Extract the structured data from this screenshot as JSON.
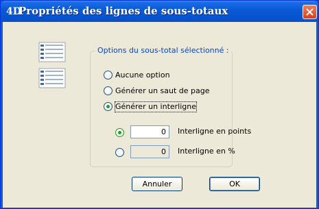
{
  "window": {
    "app_icon": "4D",
    "title": "Propriétés des lignes de sous-totaux",
    "close_icon": "close-icon"
  },
  "dialog": {
    "side_icon": "document-list-icon",
    "group_title": "Options du sous-total sélectionné :",
    "options": [
      {
        "label": "Aucune option",
        "selected": false
      },
      {
        "label": "Générer un saut de page",
        "selected": false
      },
      {
        "label": "Générer un interligne",
        "selected": true
      }
    ],
    "spacing": [
      {
        "label": "Interligne en points",
        "value": "0",
        "selected": true,
        "enabled": true
      },
      {
        "label": "Interligne en %",
        "value": "0",
        "selected": false,
        "enabled": false
      }
    ],
    "buttons": {
      "cancel": "Annuler",
      "ok": "OK"
    }
  }
}
